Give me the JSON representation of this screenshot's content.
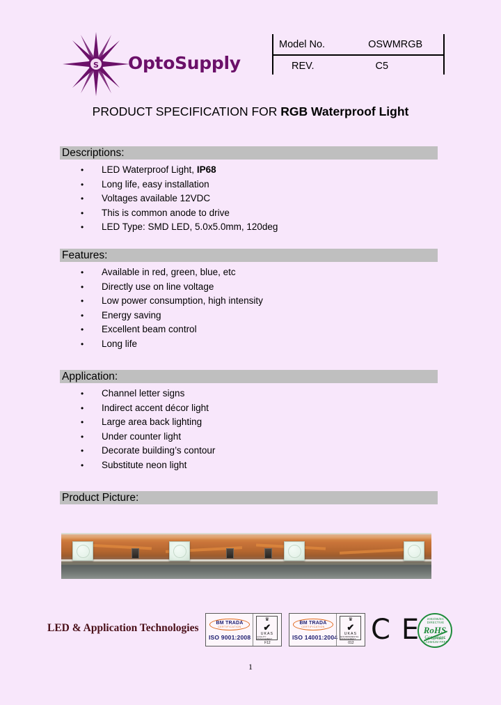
{
  "page": {
    "background_color": "#f8e7fb",
    "page_number": "1"
  },
  "header": {
    "logo": {
      "icon": "starburst-logo-icon",
      "center_letter": "S",
      "wordmark": "OptoSupply",
      "color": "#6b1069"
    },
    "model_table": {
      "rows": [
        {
          "label": "Model No.",
          "value": "OSWMRGB"
        },
        {
          "label": "REV.",
          "value": "C5"
        }
      ]
    }
  },
  "title": {
    "prefix": "PRODUCT SPECIFICATION FOR ",
    "highlight": "RGB Waterproof Light"
  },
  "sections": [
    {
      "id": "descriptions",
      "heading": "Descriptions:",
      "bullet_glyph": "•",
      "items": [
        {
          "text": "LED Waterproof Light, ",
          "bold_suffix": "IP68"
        },
        {
          "text": "Long life, easy installation",
          "bold_suffix": ""
        },
        {
          "text": "Voltages available 12VDC",
          "bold_suffix": ""
        },
        {
          "text": "This is common anode to drive",
          "bold_suffix": ""
        },
        {
          "text": "LED Type: SMD LED, 5.0x5.0mm, 120deg",
          "bold_suffix": ""
        }
      ]
    },
    {
      "id": "features",
      "heading": "Features:",
      "bullet_glyph": "•",
      "items": [
        {
          "text": "Available in red, green, blue, etc",
          "bold_suffix": ""
        },
        {
          "text": "Directly use on line voltage",
          "bold_suffix": ""
        },
        {
          "text": "Low power consumption, high intensity",
          "bold_suffix": ""
        },
        {
          "text": "Energy saving",
          "bold_suffix": ""
        },
        {
          "text": "Excellent beam control",
          "bold_suffix": ""
        },
        {
          "text": "Long life",
          "bold_suffix": ""
        }
      ]
    },
    {
      "id": "application",
      "heading": "Application:",
      "bullet_glyph": "•",
      "items": [
        {
          "text": "Channel letter signs",
          "bold_suffix": ""
        },
        {
          "text": "Indirect accent décor light",
          "bold_suffix": ""
        },
        {
          "text": "Large area back lighting",
          "bold_suffix": ""
        },
        {
          "text": "Under counter light",
          "bold_suffix": ""
        },
        {
          "text": "Decorate building’s contour",
          "bold_suffix": ""
        },
        {
          "text": "Substitute neon light",
          "bold_suffix": ""
        }
      ]
    },
    {
      "id": "product-picture",
      "heading": "Product Picture:",
      "bullet_glyph": "•",
      "items": []
    }
  ],
  "product_picture": {
    "alt": "Waterproof RGB LED strip with SMD LEDs on copper flexible PCB"
  },
  "footer": {
    "tagline": "LED & Application Technologies",
    "certifications": [
      {
        "brand": "BM TRADA",
        "brand_sub": "CERTIFICATION",
        "standard": "ISO 9001:2008",
        "accreditation": "UKAS",
        "accreditation_sub": "QUALITY MANAGEMENT",
        "code": "F12",
        "check_glyph": "✔",
        "crown_glyph": "♛"
      },
      {
        "brand": "BM TRADA",
        "brand_sub": "CERTIFICATION",
        "standard": "ISO 14001:2004",
        "accreditation": "UKAS",
        "accreditation_sub": "ENVIRONMENTAL MANAGEMENT",
        "code": "012",
        "check_glyph": "✔",
        "crown_glyph": "♛"
      }
    ],
    "ce_mark": "C E",
    "rohs": {
      "ring_top": "2002/95/EC DIRECTIVE",
      "word": "RoHS",
      "sub": "Compliant",
      "ring_bottom": "LEAD FREE • CADMIUM FREE"
    }
  },
  "colors": {
    "section_bar": "#bfbfbf",
    "page_bg": "#f8e7fb",
    "brand_purple": "#6b1069",
    "footer_maroon": "#4a0f18",
    "rohs_green": "#1f8c3c",
    "cert_orange": "#e06a1e",
    "cert_navy": "#1b1b6e"
  }
}
